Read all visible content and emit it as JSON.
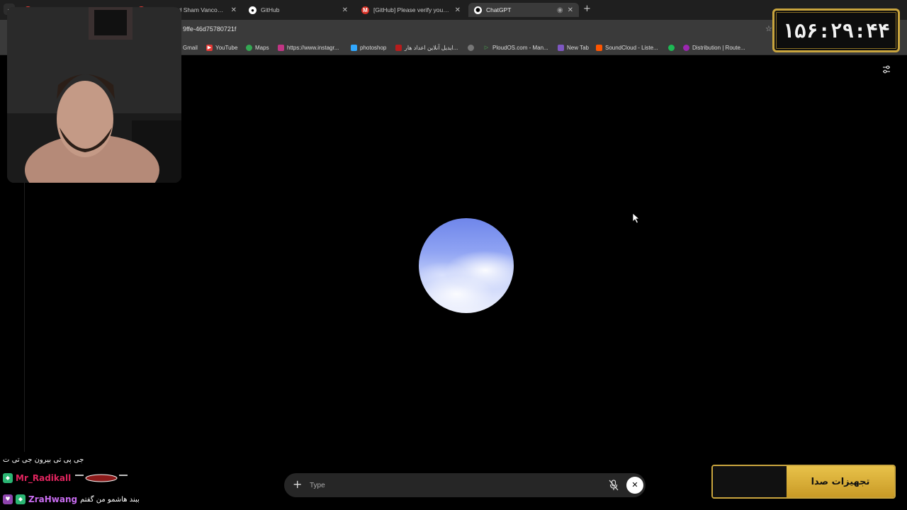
{
  "browser": {
    "tabs": [
      {
        "title": "",
        "active": false
      },
      {
        "title": "Reimagined Sham Vancouver",
        "active": false
      },
      {
        "title": "GitHub",
        "active": false
      },
      {
        "title": "[GitHub] Please verify your dev",
        "active": false
      },
      {
        "title": "ChatGPT",
        "active": true
      }
    ],
    "url": "9ffe-46d75780721f",
    "bookmarks": [
      "Gmail",
      "YouTube",
      "Maps",
      "https://www.instagr...",
      "photoshop",
      "ایدیل آنلاین اعداد هار...",
      "",
      "PloudOS.com - Man...",
      "New Tab",
      "SoundCloud - Liste...",
      "",
      "Distribution | Route..."
    ]
  },
  "composer": {
    "placeholder": "Type"
  },
  "overlay": {
    "timer": "۱۵۶:۲۹:۴۴",
    "sound_label": "تجهیزات صدا",
    "chat": [
      {
        "user": "",
        "message": "جی پی تی بیرون جی تی ت",
        "color": "#ffffff"
      },
      {
        "user": "Mr_Radikall",
        "message": "",
        "color": "#e0245e"
      },
      {
        "user": "ZraHwang",
        "message": "ببند هاشمو من گفتم",
        "color": "#c86cf0"
      }
    ]
  },
  "colors": {
    "accent_gold": "#c9a53e",
    "orb_blue": "#6f86ea"
  }
}
